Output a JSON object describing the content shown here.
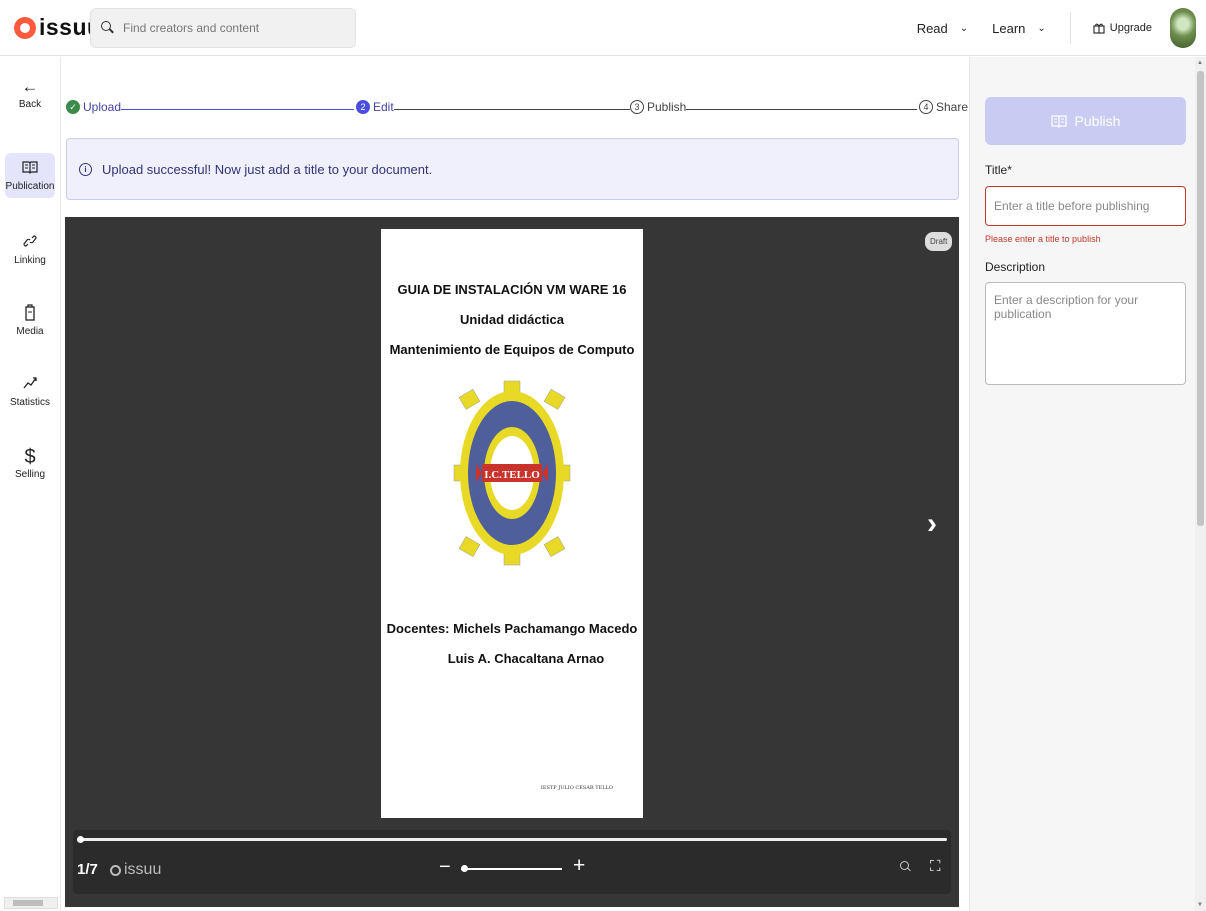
{
  "header": {
    "logo_text": "issuu",
    "search_placeholder": "Find creators and content",
    "nav": [
      {
        "label": "Read"
      },
      {
        "label": "Learn"
      }
    ],
    "upgrade_label": "Upgrade"
  },
  "sidebar": {
    "items": [
      {
        "label": "Back",
        "icon": "arrow-left-icon",
        "glyph": "←"
      },
      {
        "label": "Publication",
        "icon": "book-open-icon",
        "glyph": "🕮",
        "active": true
      },
      {
        "label": "Linking",
        "icon": "link-icon",
        "glyph": "🔗"
      },
      {
        "label": "Media",
        "icon": "media-icon",
        "glyph": "▯"
      },
      {
        "label": "Statistics",
        "icon": "chart-trend-icon",
        "glyph": "↗"
      },
      {
        "label": "Selling",
        "icon": "dollar-icon",
        "glyph": "$"
      }
    ]
  },
  "steps": [
    {
      "number": "✓",
      "label": "Upload",
      "state": "done"
    },
    {
      "number": "2",
      "label": "Edit",
      "state": "current"
    },
    {
      "number": "3",
      "label": "Publish",
      "state": "todo"
    },
    {
      "number": "4",
      "label": "Share",
      "state": "todo"
    }
  ],
  "banner": {
    "message": "Upload successful! Now just add a title to your document."
  },
  "viewer": {
    "draft_badge": "Draft",
    "document": {
      "lines": [
        "GUIA DE INSTALACIÓN VM WARE 16",
        "Unidad didáctica",
        "Mantenimiento de Equipos de Computo",
        "Docentes: Michels Pachamango Macedo",
        "Luis A. Chacaltana Arnao"
      ],
      "seal_center_text": "I.C.TELLO",
      "footer_text": "IESTP JULIO CESAR TELLO"
    },
    "page_counter": "1/7",
    "viewer_logo": "issuu",
    "progress": 0.0,
    "zoom_level": 0.0
  },
  "panel": {
    "publish_label": "Publish",
    "title_label": "Title*",
    "title_placeholder": "Enter a title before publishing",
    "title_error": "Please enter a title to publish",
    "description_label": "Description",
    "description_placeholder": "Enter a description for your publication"
  },
  "colors": {
    "accent": "#4a4de0",
    "publish_disabled": "#c9cbf2",
    "error": "#c0392b",
    "viewer_bg": "#363636",
    "brand": "#ff5a3c"
  }
}
